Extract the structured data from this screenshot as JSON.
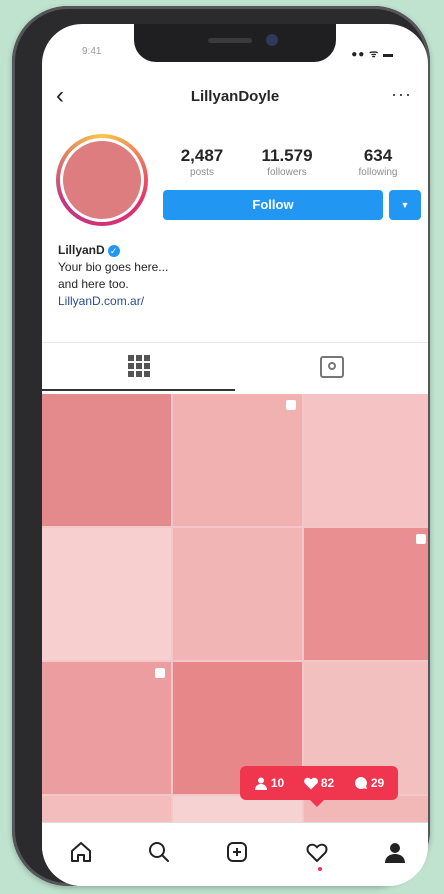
{
  "status": {
    "time": "9:41",
    "signal": "●● ᯤ ▬"
  },
  "header": {
    "back": "‹",
    "username": "LillyanDoyle",
    "more": "···"
  },
  "profile": {
    "stats": [
      {
        "value": "2,487",
        "label": "posts"
      },
      {
        "value": "11.579",
        "label": "followers"
      },
      {
        "value": "634",
        "label": "following"
      }
    ],
    "follow_label": "Follow",
    "dropdown": "▼",
    "display_name": "LillyanD",
    "verified_mark": "✓",
    "bio_line1": "Your bio goes here...",
    "bio_line2": "and here too.",
    "link": "LillyanD.com.ar/"
  },
  "notification": {
    "followers": "10",
    "likes": "82",
    "comments": "29"
  },
  "feed_colors": [
    "#e58a8c",
    "#f1b1b1",
    "#f5c3c3",
    "#f7cfcf",
    "#f2b5b5",
    "#ea8f91",
    "#ec9d9f",
    "#e8878a",
    "#f3c0c0",
    "#f4bdbd",
    "#f7d2d2",
    "#f2b7b7"
  ],
  "colors": {
    "accent": "#2196f3",
    "notification": "#f0364f",
    "photo": "#dd7d7f"
  },
  "icons": {
    "home": "home-icon",
    "search": "search-icon",
    "add": "add-icon",
    "heart": "heart-icon",
    "profile": "profile-icon"
  }
}
